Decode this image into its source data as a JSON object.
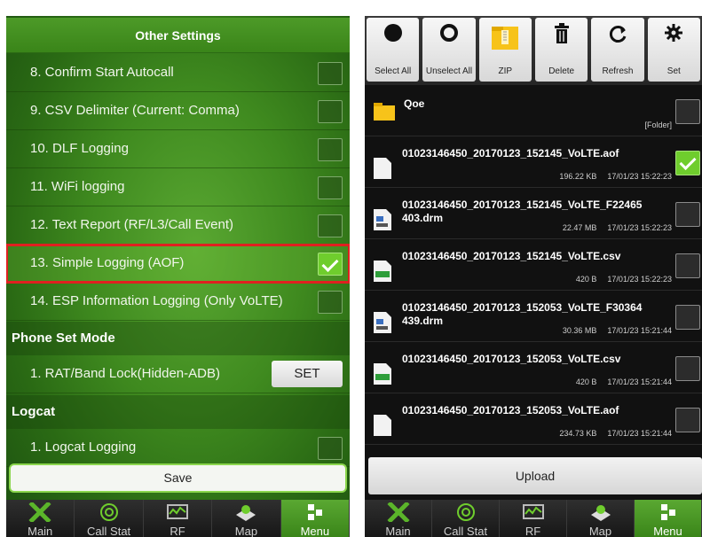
{
  "left": {
    "title": "Other Settings",
    "items": [
      {
        "label": "8. Confirm Start Autocall",
        "checked": false
      },
      {
        "label": "9. CSV Delimiter (Current: Comma)",
        "checked": false
      },
      {
        "label": "10. DLF Logging",
        "checked": false
      },
      {
        "label": "11. WiFi logging",
        "checked": false
      },
      {
        "label": "12. Text Report (RF/L3/Call Event)",
        "checked": false
      },
      {
        "label": "13. Simple Logging (AOF)",
        "checked": true
      },
      {
        "label": "14. ESP Information Logging (Only VoLTE)",
        "checked": false
      }
    ],
    "phone_set_mode": {
      "header": "Phone Set Mode",
      "item_label": "1. RAT/Band Lock(Hidden-ADB)",
      "button_label": "SET"
    },
    "logcat": {
      "header": "Logcat",
      "item_label": "1. Logcat Logging"
    },
    "save_label": "Save"
  },
  "nav": {
    "items": [
      {
        "label": "Main",
        "icon": "x-main-icon"
      },
      {
        "label": "Call Stat",
        "icon": "call-stat-icon"
      },
      {
        "label": "RF",
        "icon": "rf-icon"
      },
      {
        "label": "Map",
        "icon": "map-icon"
      },
      {
        "label": "Menu",
        "icon": "menu-icon",
        "active": true
      }
    ]
  },
  "right": {
    "toolbar": [
      {
        "label": "Select All",
        "icon": "select-all-icon"
      },
      {
        "label": "Unselect All",
        "icon": "unselect-all-icon"
      },
      {
        "label": "ZIP",
        "icon": "zip-folder-icon"
      },
      {
        "label": "Delete",
        "icon": "trash-icon"
      },
      {
        "label": "Refresh",
        "icon": "refresh-icon"
      },
      {
        "label": "Set",
        "icon": "gear-icon"
      }
    ],
    "files": [
      {
        "name": "Qoe",
        "size": "",
        "date": "",
        "type": "[Folder]",
        "checked": false
      },
      {
        "name": "01023146450_20170123_152145_VoLTE.aof",
        "size": "196.22 KB",
        "date": "17/01/23 15:22:23",
        "checked": true
      },
      {
        "name": "01023146450_20170123_152145_VoLTE_F22465 403.drm",
        "size": "22.47 MB",
        "date": "17/01/23 15:22:23",
        "checked": false
      },
      {
        "name": "01023146450_20170123_152145_VoLTE.csv",
        "size": "420 B",
        "date": "17/01/23 15:22:23",
        "checked": false
      },
      {
        "name": "01023146450_20170123_152053_VoLTE_F30364 439.drm",
        "size": "30.36 MB",
        "date": "17/01/23 15:21:44",
        "checked": false
      },
      {
        "name": "01023146450_20170123_152053_VoLTE.csv",
        "size": "420 B",
        "date": "17/01/23 15:21:44",
        "checked": false
      },
      {
        "name": "01023146450_20170123_152053_VoLTE.aof",
        "size": "234.73 KB",
        "date": "17/01/23 15:21:44",
        "checked": false
      }
    ],
    "upload_label": "Upload"
  },
  "colors": {
    "accent_green": "#6fcd2d",
    "highlight_red": "#e02020"
  }
}
